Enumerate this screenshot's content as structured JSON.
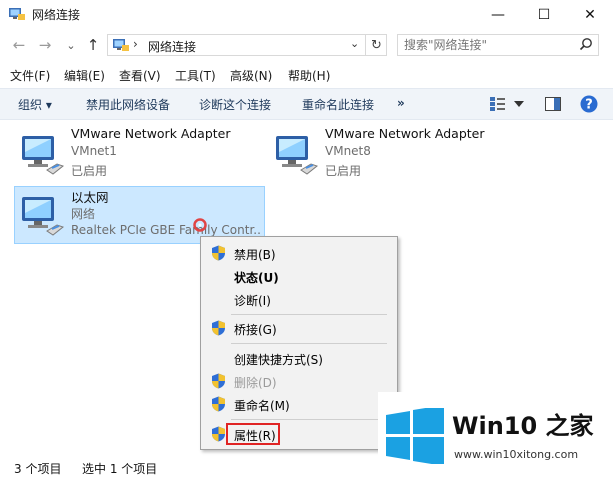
{
  "window": {
    "title": "网络连接",
    "controls": {
      "minimize": "—",
      "maximize": "☐",
      "close": "✕"
    }
  },
  "address": {
    "path": "网络连接",
    "separator": "›",
    "dropdown": "⌄",
    "refresh": "↻",
    "back": "←",
    "forward": "→",
    "recent": "⌄",
    "up": "↑"
  },
  "search": {
    "placeholder": "搜索\"网络连接\"",
    "icon": "search-icon"
  },
  "menu": [
    "文件(F)",
    "编辑(E)",
    "查看(V)",
    "工具(T)",
    "高级(N)",
    "帮助(H)"
  ],
  "commands": {
    "organize": "组织 ▾",
    "disable": "禁用此网络设备",
    "diagnose": "诊断这个连接",
    "rename": "重命名此连接",
    "more": "»"
  },
  "adapters": [
    {
      "name": "VMware Network Adapter",
      "desc": "VMnet1",
      "status": "已启用"
    },
    {
      "name": "VMware Network Adapter",
      "desc": "VMnet8",
      "status": "已启用"
    },
    {
      "name": "以太网",
      "desc": "网络",
      "status": "Realtek PCIe GBE Family Contr..."
    }
  ],
  "context_menu": [
    {
      "label": "禁用(B)",
      "shield": true
    },
    {
      "label": "状态(U)",
      "bold": true
    },
    {
      "label": "诊断(I)"
    },
    {
      "label": "桥接(G)",
      "shield": true
    },
    {
      "label": "创建快捷方式(S)"
    },
    {
      "label": "删除(D)",
      "shield": true,
      "disabled": true
    },
    {
      "label": "重命名(M)",
      "shield": true
    },
    {
      "label": "属性(R)",
      "shield": true,
      "highlighted": true
    }
  ],
  "status": {
    "count": "3 个项目",
    "selected": "选中 1 个项目"
  },
  "watermark": {
    "title": "Win10 之家",
    "url": "www.win10xitong.com"
  },
  "colors": {
    "accent": "#0078d7",
    "selection": "#cce8ff",
    "highlight_box": "#e02424"
  }
}
